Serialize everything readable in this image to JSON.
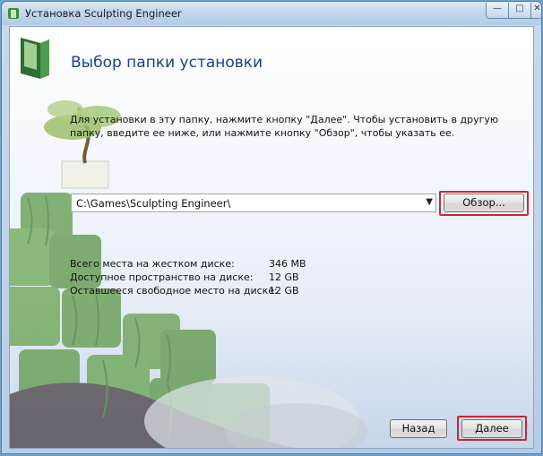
{
  "window": {
    "title": "Установка Sculpting Engineer",
    "controls": {
      "minimize": "—",
      "maximize": "□",
      "close": "✕"
    }
  },
  "header": {
    "title": "Выбор папки установки"
  },
  "description": "Для установки в эту папку, нажмите кнопку \"Далее\". Чтобы установить в другую папку, введите ее ниже, или нажмите кнопку \"Обзор\", чтобы указать ее.",
  "folder": {
    "value": "C:\\Games\\Sculpting Engineer\\"
  },
  "buttons": {
    "browse": "Обзор...",
    "back": "Назад",
    "next": "Далее"
  },
  "disk_info": [
    {
      "label": "Всего места на жестком диске:",
      "value": "346 MB"
    },
    {
      "label": "Доступное пространство на диске:",
      "value": "12 GB"
    },
    {
      "label": "Оставшееся свободное место на диске:",
      "value": "12 GB"
    }
  ],
  "colors": {
    "highlight": "#d4232f",
    "title_blue": "#1b3f8f"
  }
}
